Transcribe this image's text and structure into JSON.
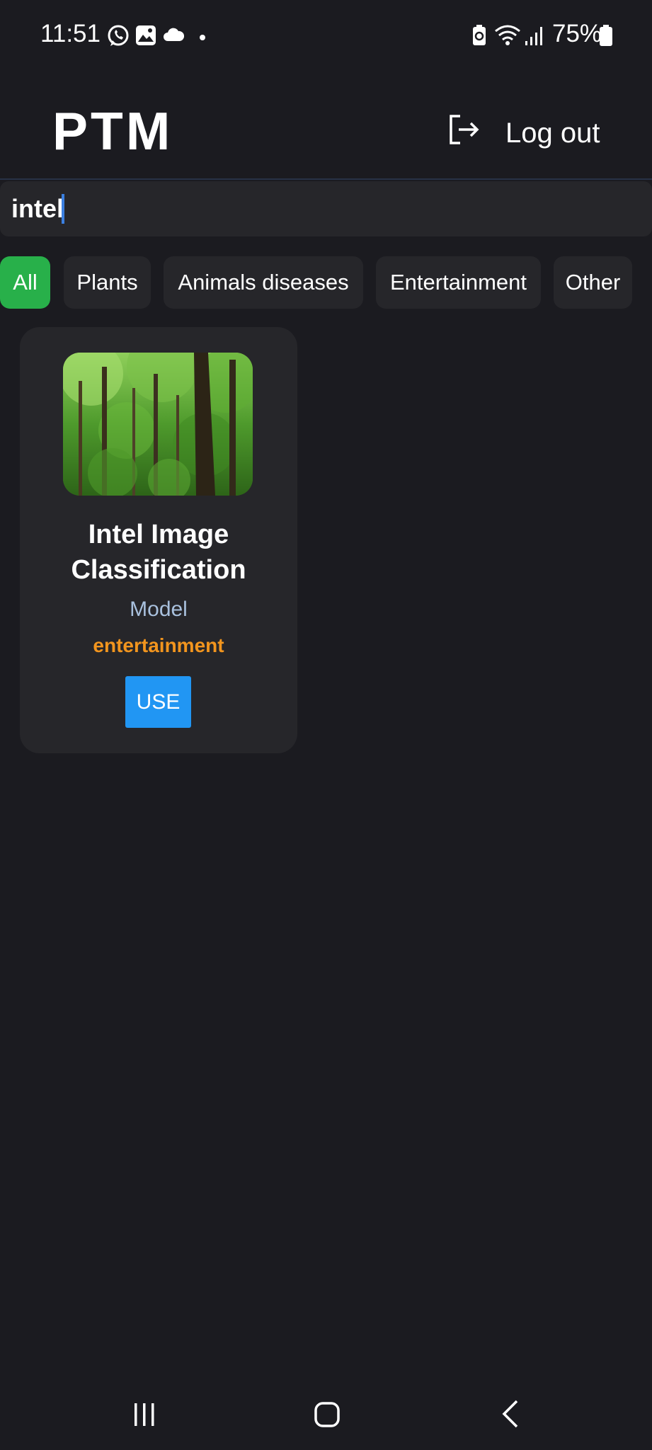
{
  "status_bar": {
    "time": "11:51",
    "battery_percent": "75%",
    "left_icons": [
      "whatsapp-icon",
      "gallery-icon",
      "cloud-icon",
      "dot-icon"
    ],
    "right_icons": [
      "battery-saver-icon",
      "wifi-icon",
      "signal-icon",
      "battery-icon"
    ]
  },
  "header": {
    "title": "PTM",
    "logout_label": "Log out"
  },
  "search": {
    "value": "intel",
    "placeholder": ""
  },
  "filters": [
    {
      "label": "All",
      "active": true
    },
    {
      "label": "Plants",
      "active": false
    },
    {
      "label": "Animals diseases",
      "active": false
    },
    {
      "label": "Entertainment",
      "active": false
    },
    {
      "label": "Other",
      "active": false
    }
  ],
  "results": [
    {
      "title": "Intel Image Classification",
      "type": "Model",
      "category": "entertainment",
      "action_label": "USE"
    }
  ],
  "colors": {
    "background": "#1b1b20",
    "surface": "#26262a",
    "active_chip": "#28b04a",
    "category_text": "#f2951e",
    "type_text": "#a9c1de",
    "primary_button": "#2196f3"
  },
  "nav_icons": [
    "recent-apps-icon",
    "home-icon",
    "back-icon"
  ]
}
